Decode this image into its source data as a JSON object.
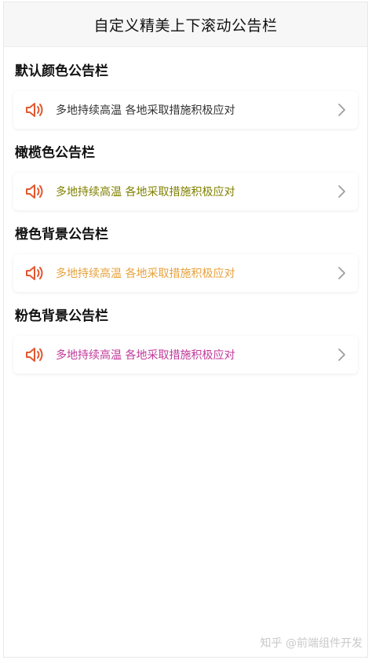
{
  "header": {
    "title": "自定义精美上下滚动公告栏"
  },
  "sections": [
    {
      "title": "默认颜色公告栏",
      "notice": "多地持续高温 各地采取措施积极应对",
      "color": "#333333"
    },
    {
      "title": "橄榄色公告栏",
      "notice": "多地持续高温 各地采取措施积极应对",
      "color": "#808000"
    },
    {
      "title": "橙色背景公告栏",
      "notice": "多地持续高温 各地采取措施积极应对",
      "color": "#e6a23c"
    },
    {
      "title": "粉色背景公告栏",
      "notice": "多地持续高温 各地采取措施积极应对",
      "color": "#c0399b"
    }
  ],
  "watermark": {
    "text": "知乎 @前端组件开发"
  },
  "colors": {
    "speaker": "#e2572f",
    "chevron": "#999999"
  },
  "icons": {
    "speaker": "speaker-icon",
    "chevron": "chevron-right-icon"
  }
}
